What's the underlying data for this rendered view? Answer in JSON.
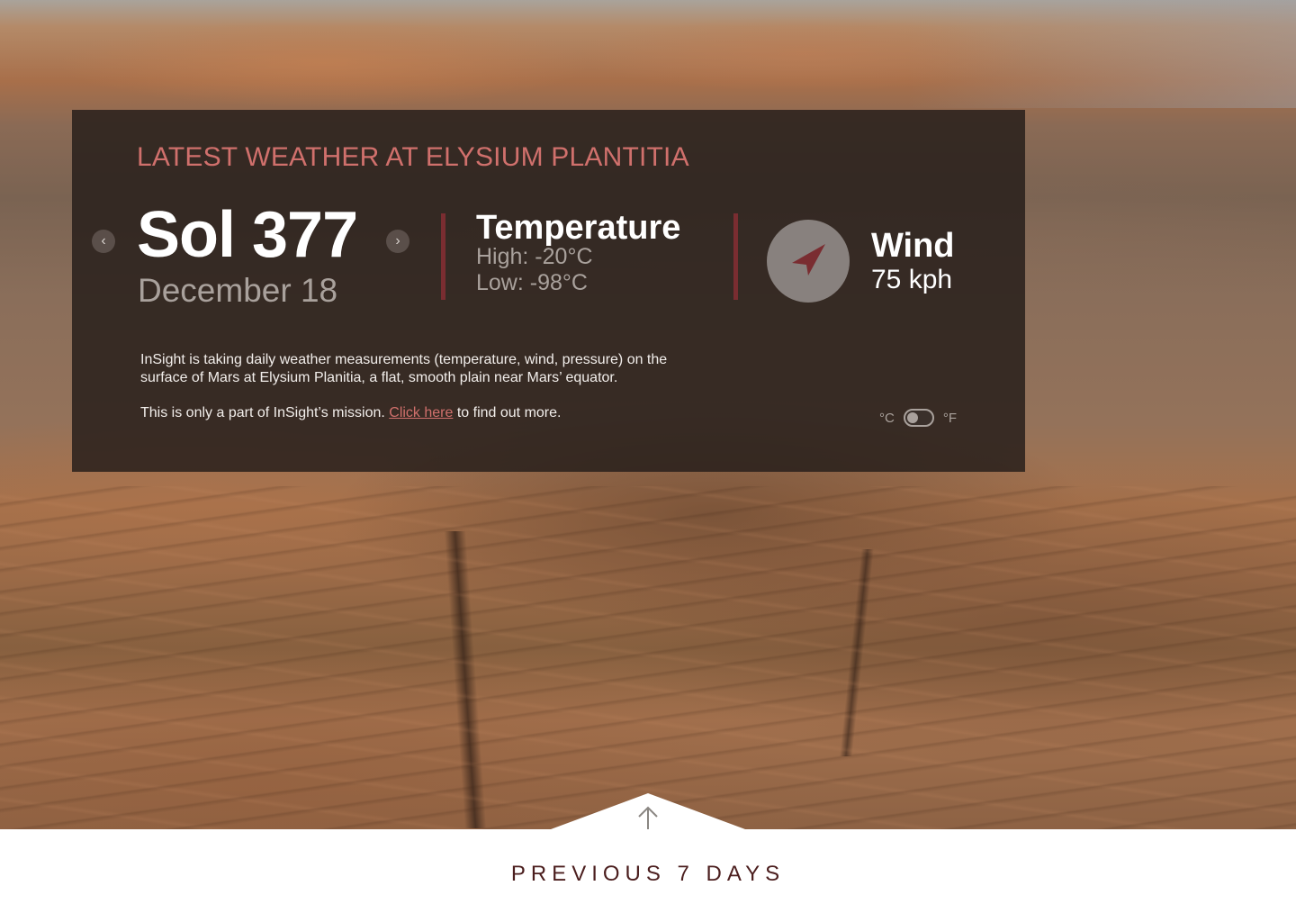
{
  "weather": {
    "headline": "LATEST WEATHER AT ELYSIUM PLANTITIA",
    "sol": "Sol 377",
    "date": "December 18",
    "temperature": {
      "title": "Temperature",
      "high": "High: -20°C",
      "low": "Low: -98°C"
    },
    "wind": {
      "title": "Wind",
      "speed": "75 kph",
      "direction_icon": "compass-arrow-icon"
    }
  },
  "info": {
    "paragraph": "InSight is taking daily weather measurements (temperature, wind, pressure) on the surface of Mars at Elysium Planitia, a flat, smooth plain near Mars’ equator.",
    "mission_prefix": "This is only a part of InSight’s mission. ",
    "link_label": "Click here",
    "mission_suffix": " to find out more."
  },
  "units": {
    "celsius_label": "°C",
    "fahrenheit_label": "°F",
    "selected": "°C"
  },
  "nav": {
    "prev_icon": "chevron-left-icon",
    "next_icon": "chevron-right-icon",
    "prev_glyph": "‹",
    "next_glyph": "›"
  },
  "footer": {
    "previous_label": "PREVIOUS 7 DAYS"
  },
  "colors": {
    "accent": "#d0706c",
    "divider": "#7a2d31",
    "footer_text": "#4b1e1e"
  }
}
